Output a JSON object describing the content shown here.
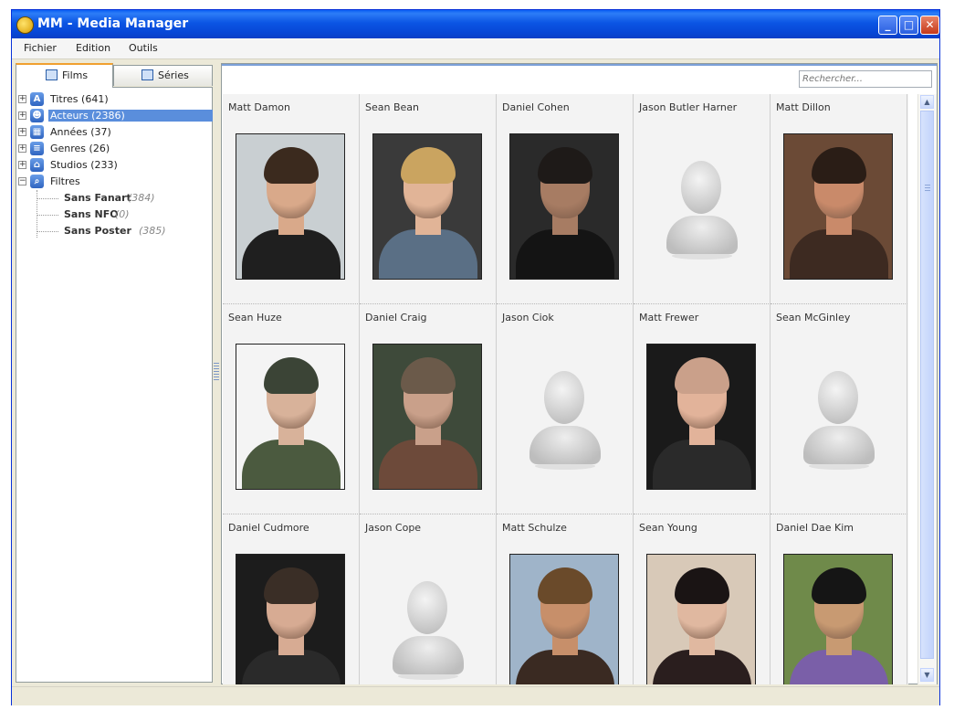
{
  "window": {
    "title": "MM - Media Manager",
    "controls": {
      "minimize": "_",
      "maximize": "□",
      "close": "✕"
    }
  },
  "menu": [
    "Fichier",
    "Edition",
    "Outils"
  ],
  "tabs": [
    {
      "label": "Films",
      "icon": "film-icon",
      "active": true
    },
    {
      "label": "Séries",
      "icon": "tv-icon",
      "active": false
    }
  ],
  "tree": {
    "nodes": [
      {
        "label": "Titres (641)",
        "icon": "letter-a-icon",
        "glyph": "A",
        "expander": "+"
      },
      {
        "label": "Acteurs (2386)",
        "icon": "person-icon",
        "glyph": "☻",
        "expander": "+",
        "selected": true
      },
      {
        "label": "Années (37)",
        "icon": "calendar-icon",
        "glyph": "▦",
        "expander": "+"
      },
      {
        "label": "Genres (26)",
        "icon": "database-icon",
        "glyph": "≡",
        "expander": "+"
      },
      {
        "label": "Studios (233)",
        "icon": "house-icon",
        "glyph": "⌂",
        "expander": "+"
      },
      {
        "label": "Filtres",
        "icon": "magnifier-icon",
        "glyph": "⌕",
        "expander": "−"
      }
    ],
    "filters": [
      {
        "label": "Sans Fanart",
        "count": "(384)"
      },
      {
        "label": "Sans NFO",
        "count": "(0)"
      },
      {
        "label": "Sans Poster",
        "count": "(385)"
      }
    ]
  },
  "search": {
    "placeholder": "Rechercher..."
  },
  "actors": [
    {
      "name": "Matt Damon",
      "photo": true,
      "colors": [
        "#c9cfd2",
        "#3b2a1e",
        "#d9a98a",
        "#1f1f1f"
      ]
    },
    {
      "name": "Sean Bean",
      "photo": true,
      "colors": [
        "#3a3a3a",
        "#caa460",
        "#e1b497",
        "#5a6f85"
      ]
    },
    {
      "name": "Daniel Cohen",
      "photo": true,
      "colors": [
        "#2a2a2a",
        "#1e1a18",
        "#a77c63",
        "#141414"
      ]
    },
    {
      "name": "Jason Butler Harner",
      "photo": false
    },
    {
      "name": "Matt Dillon",
      "photo": true,
      "colors": [
        "#6b4a36",
        "#2a1d16",
        "#c98a6a",
        "#3d2a21"
      ]
    },
    {
      "name": "Sean Huze",
      "photo": true,
      "colors": [
        "#f4f4f4",
        "#3b4436",
        "#d8b29a",
        "#4b5a3f"
      ]
    },
    {
      "name": "Daniel Craig",
      "photo": true,
      "colors": [
        "#3e4a3a",
        "#6b5a4a",
        "#c9a08a",
        "#6d4a3a"
      ]
    },
    {
      "name": "Jason Ciok",
      "photo": false
    },
    {
      "name": "Matt Frewer",
      "photo": true,
      "colors": [
        "#1a1a1a",
        "#caa08a",
        "#e2b39a",
        "#2a2a2a"
      ]
    },
    {
      "name": "Sean McGinley",
      "photo": false
    },
    {
      "name": "Daniel Cudmore",
      "photo": true,
      "colors": [
        "#1c1c1c",
        "#3a2e26",
        "#d7ab93",
        "#2a2a2a"
      ]
    },
    {
      "name": "Jason Cope",
      "photo": false
    },
    {
      "name": "Matt Schulze",
      "photo": true,
      "colors": [
        "#9fb4c9",
        "#6a4a2a",
        "#c78f6a",
        "#3a2a22"
      ]
    },
    {
      "name": "Sean Young",
      "photo": true,
      "colors": [
        "#d8c9b8",
        "#1a1414",
        "#e0b8a0",
        "#2a1e1e"
      ]
    },
    {
      "name": "Daniel Dae Kim",
      "photo": true,
      "colors": [
        "#6f8a4a",
        "#151515",
        "#c89a72",
        "#7a5fa8"
      ]
    }
  ]
}
